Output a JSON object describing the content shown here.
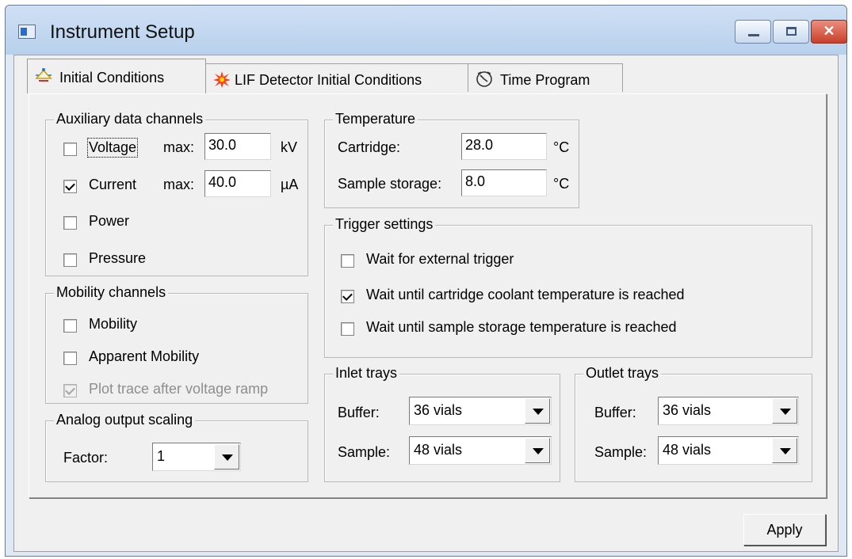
{
  "window": {
    "title": "Instrument Setup"
  },
  "tabs": [
    {
      "label": "Initial Conditions",
      "active": true
    },
    {
      "label": "LIF Detector Initial Conditions",
      "active": false
    },
    {
      "label": "Time Program",
      "active": false
    }
  ],
  "auxiliary": {
    "title": "Auxiliary data channels",
    "voltage": {
      "label": "Voltage",
      "checked": false,
      "max_label": "max:",
      "value": "30.0",
      "unit": "kV"
    },
    "current": {
      "label": "Current",
      "checked": true,
      "max_label": "max:",
      "value": "40.0",
      "unit": "µA"
    },
    "power": {
      "label": "Power",
      "checked": false
    },
    "pressure": {
      "label": "Pressure",
      "checked": false
    }
  },
  "mobility": {
    "title": "Mobility channels",
    "mobility": {
      "label": "Mobility",
      "checked": false
    },
    "apparent": {
      "label": "Apparent Mobility",
      "checked": false
    },
    "plot_trace": {
      "label": "Plot trace after voltage ramp",
      "checked": true,
      "disabled": true
    }
  },
  "analog": {
    "title": "Analog output scaling",
    "factor_label": "Factor:",
    "factor_value": "1"
  },
  "temperature": {
    "title": "Temperature",
    "cartridge": {
      "label": "Cartridge:",
      "value": "28.0",
      "unit": "°C"
    },
    "storage": {
      "label": "Sample storage:",
      "value": "8.0",
      "unit": "°C"
    }
  },
  "trigger": {
    "title": "Trigger settings",
    "external": {
      "label": "Wait for external trigger",
      "checked": false
    },
    "coolant": {
      "label": "Wait until cartridge coolant temperature is reached",
      "checked": true
    },
    "storage": {
      "label": "Wait until sample storage temperature is reached",
      "checked": false
    }
  },
  "inlet": {
    "title": "Inlet trays",
    "buffer_label": "Buffer:",
    "buffer_value": "36 vials",
    "sample_label": "Sample:",
    "sample_value": "48 vials"
  },
  "outlet": {
    "title": "Outlet trays",
    "buffer_label": "Buffer:",
    "buffer_value": "36 vials",
    "sample_label": "Sample:",
    "sample_value": "48 vials"
  },
  "buttons": {
    "apply": "Apply"
  }
}
